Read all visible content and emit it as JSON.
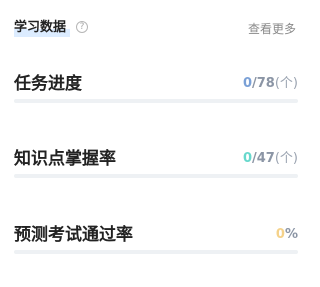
{
  "header": {
    "title": "学习数据",
    "help_icon": "help-circle-icon",
    "help_glyph": "?",
    "more_label": "查看更多"
  },
  "rows": [
    {
      "label": "任务进度",
      "current": "0",
      "total": "/78",
      "unit": "(个)",
      "current_color": "#7aa0d6"
    },
    {
      "label": "知识点掌握率",
      "current": "0",
      "total": "/47",
      "unit": "(个)",
      "current_color": "#67d8cc"
    },
    {
      "label": "预测考试通过率",
      "current": "0",
      "total": "%",
      "unit": "",
      "current_color": "#f5d28a"
    }
  ]
}
